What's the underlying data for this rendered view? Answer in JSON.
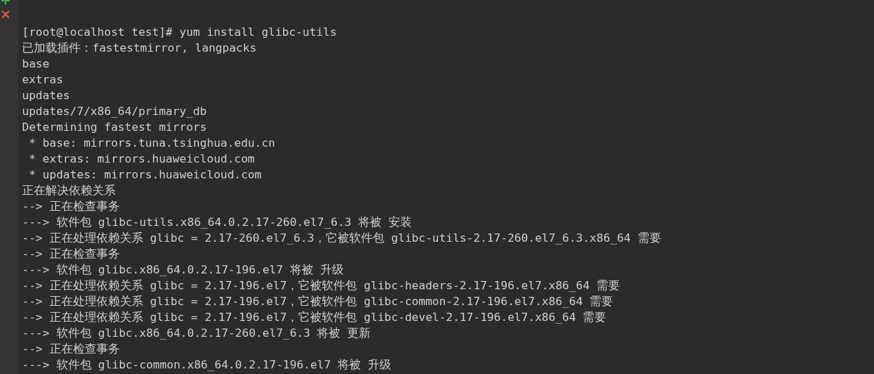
{
  "terminal": {
    "lines": [
      "[root@localhost test]# yum install glibc-utils",
      "已加载插件：fastestmirror, langpacks",
      "base",
      "extras",
      "updates",
      "updates/7/x86_64/primary_db",
      "Determining fastest mirrors",
      " * base: mirrors.tuna.tsinghua.edu.cn",
      " * extras: mirrors.huaweicloud.com",
      " * updates: mirrors.huaweicloud.com",
      "正在解决依赖关系",
      "--> 正在检查事务",
      "---> 软件包 glibc-utils.x86_64.0.2.17-260.el7_6.3 将被 安装",
      "--> 正在处理依赖关系 glibc = 2.17-260.el7_6.3，它被软件包 glibc-utils-2.17-260.el7_6.3.x86_64 需要",
      "--> 正在检查事务",
      "---> 软件包 glibc.x86_64.0.2.17-196.el7 将被 升级",
      "--> 正在处理依赖关系 glibc = 2.17-196.el7，它被软件包 glibc-headers-2.17-196.el7.x86_64 需要",
      "--> 正在处理依赖关系 glibc = 2.17-196.el7，它被软件包 glibc-common-2.17-196.el7.x86_64 需要",
      "--> 正在处理依赖关系 glibc = 2.17-196.el7，它被软件包 glibc-devel-2.17-196.el7.x86_64 需要",
      "---> 软件包 glibc.x86_64.0.2.17-260.el7_6.3 将被 更新",
      "--> 正在检查事务",
      "---> 软件包 glibc-common.x86_64.0.2.17-196.el7 将被 升级"
    ]
  }
}
